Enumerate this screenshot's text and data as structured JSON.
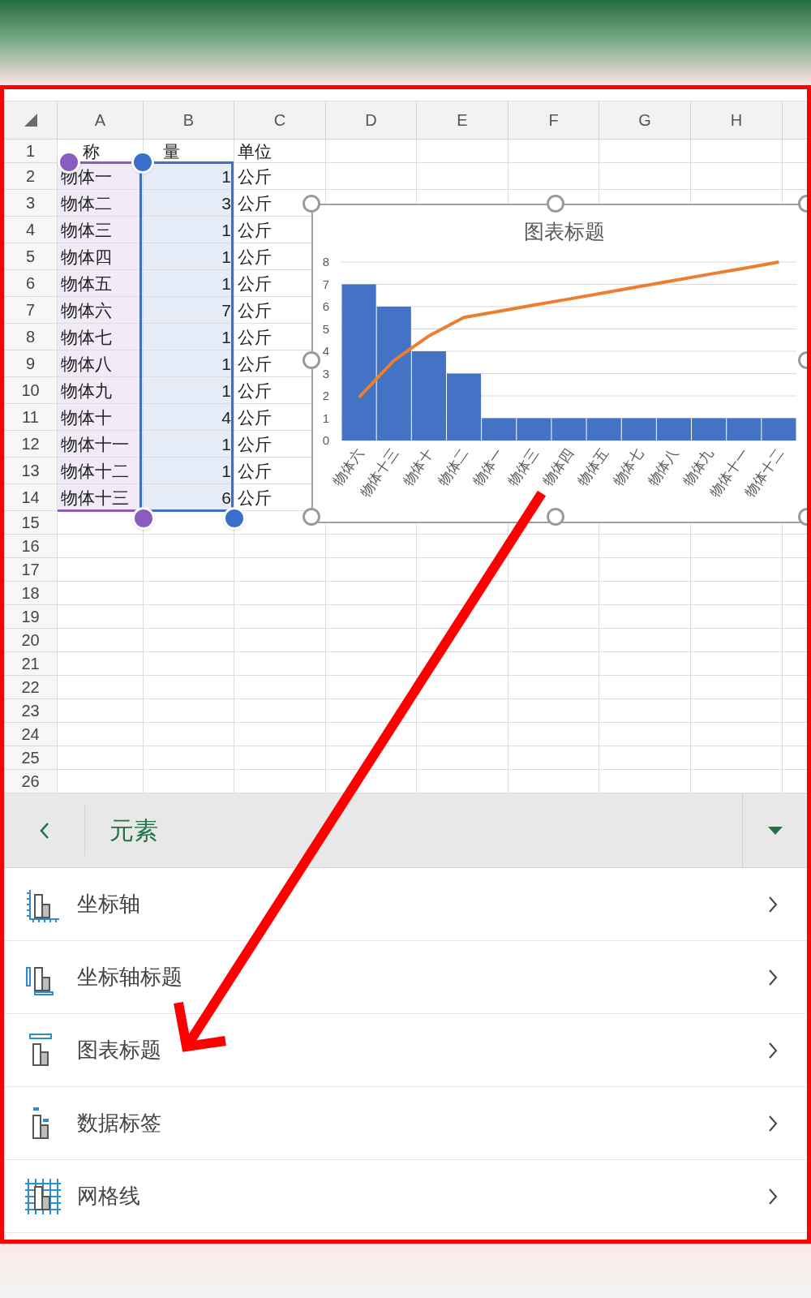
{
  "sheet": {
    "columns": [
      "A",
      "B",
      "C",
      "D",
      "E",
      "F",
      "G",
      "H"
    ],
    "rows": [
      {
        "number": "1",
        "kind": "header",
        "selected": false,
        "cells": [
          "称",
          "量",
          "单位"
        ]
      },
      {
        "number": "2",
        "selected": true,
        "cells": [
          "物体一",
          "1",
          "公斤"
        ]
      },
      {
        "number": "3",
        "selected": true,
        "cells": [
          "物体二",
          "3",
          "公斤"
        ]
      },
      {
        "number": "4",
        "selected": true,
        "cells": [
          "物体三",
          "1",
          "公斤"
        ]
      },
      {
        "number": "5",
        "selected": true,
        "cells": [
          "物体四",
          "1",
          "公斤"
        ]
      },
      {
        "number": "6",
        "selected": true,
        "cells": [
          "物体五",
          "1",
          "公斤"
        ]
      },
      {
        "number": "7",
        "selected": true,
        "cells": [
          "物体六",
          "7",
          "公斤"
        ]
      },
      {
        "number": "8",
        "selected": true,
        "cells": [
          "物体七",
          "1",
          "公斤"
        ]
      },
      {
        "number": "9",
        "selected": true,
        "cells": [
          "物体八",
          "1",
          "公斤"
        ]
      },
      {
        "number": "10",
        "selected": true,
        "cells": [
          "物体九",
          "1",
          "公斤"
        ]
      },
      {
        "number": "11",
        "selected": true,
        "cells": [
          "物体十",
          "4",
          "公斤"
        ]
      },
      {
        "number": "12",
        "selected": true,
        "cells": [
          "物体十一",
          "1",
          "公斤"
        ]
      },
      {
        "number": "13",
        "selected": true,
        "cells": [
          "物体十二",
          "1",
          "公斤"
        ]
      },
      {
        "number": "14",
        "selected": true,
        "cells": [
          "物体十三",
          "6",
          "公斤"
        ]
      },
      {
        "number": "15",
        "selected": false
      },
      {
        "number": "16",
        "selected": false
      },
      {
        "number": "17",
        "selected": false
      },
      {
        "number": "18",
        "selected": false
      },
      {
        "number": "19",
        "selected": false
      },
      {
        "number": "20",
        "selected": false
      },
      {
        "number": "21",
        "selected": false
      },
      {
        "number": "22",
        "selected": false
      },
      {
        "number": "23",
        "selected": false
      },
      {
        "number": "24",
        "selected": false
      },
      {
        "number": "25",
        "selected": false
      },
      {
        "number": "26",
        "selected": false
      }
    ]
  },
  "chart": {
    "selected": true,
    "chart_data": {
      "type": "bar",
      "title": "图表标题",
      "categories": [
        "物体六",
        "物体十三",
        "物体十",
        "物体二",
        "物体一",
        "物体三",
        "物体四",
        "物体五",
        "物体七",
        "物体八",
        "物体九",
        "物体十一",
        "物体十二"
      ],
      "series": [
        {
          "color": "#4472c4",
          "values": [
            7,
            6,
            4,
            3,
            1,
            1,
            1,
            1,
            1,
            1,
            1,
            1,
            1
          ]
        },
        {
          "type": "line",
          "color": "#ed7d31",
          "values": [
            1.93,
            3.59,
            4.69,
            5.52,
            5.79,
            6.07,
            6.34,
            6.62,
            6.9,
            7.17,
            7.45,
            7.72,
            8
          ]
        }
      ],
      "grid": true,
      "ylim": [
        0,
        8
      ],
      "yticks": [
        0,
        1,
        2,
        3,
        4,
        5,
        6,
        7,
        8
      ]
    }
  },
  "panel": {
    "title": "元素",
    "items": [
      {
        "kind": "axes",
        "label": "坐标轴"
      },
      {
        "kind": "axis_titles",
        "label": "坐标轴标题"
      },
      {
        "kind": "chart_title",
        "label": "图表标题"
      },
      {
        "kind": "data_labels",
        "label": "数据标签"
      },
      {
        "kind": "gridlines",
        "label": "网格线"
      }
    ]
  }
}
